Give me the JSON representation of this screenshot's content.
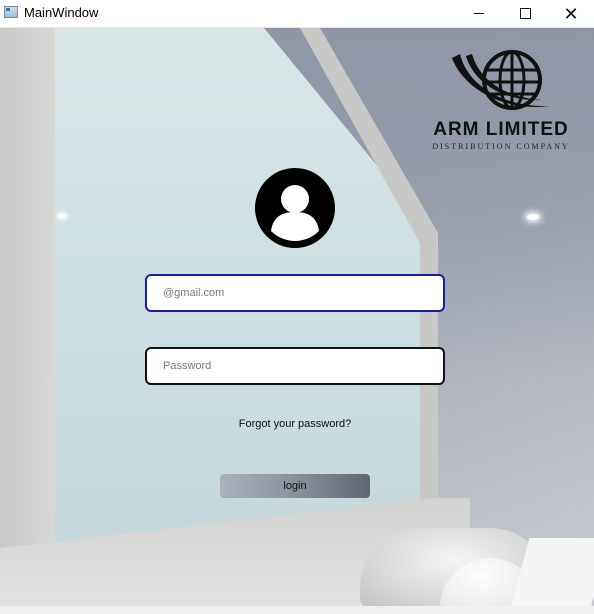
{
  "window": {
    "title": "MainWindow",
    "controls": {
      "minimize": "minimize",
      "maximize": "maximize",
      "close": "✕"
    }
  },
  "logo": {
    "name": "ARM LIMITED",
    "tagline": "DISTRIBUTION COMPANY",
    "icon": "globe-swoosh-icon"
  },
  "login": {
    "avatar_icon": "user-avatar-icon",
    "email": {
      "value": "",
      "placeholder": "@gmail.com"
    },
    "password": {
      "value": "",
      "placeholder": "Password"
    },
    "forgot_label": "Forgot your password?",
    "login_label": "login"
  },
  "colors": {
    "email_border": "#1a1ab8",
    "password_border": "#111111",
    "button_gradient_start": "#a9b2bd",
    "button_gradient_end": "#5f6570"
  }
}
